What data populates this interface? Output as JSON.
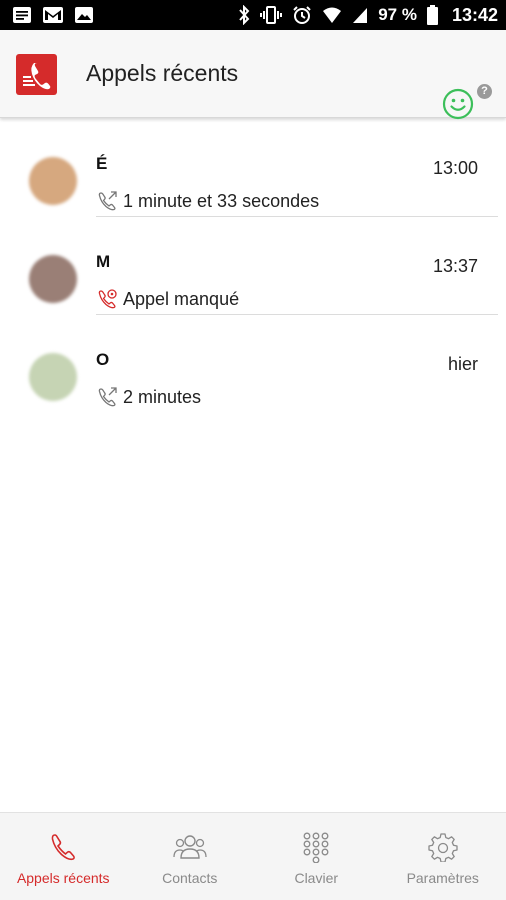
{
  "status_bar": {
    "battery": "97 %",
    "time": "13:42"
  },
  "app_bar": {
    "title": "Appels récents",
    "help": "?"
  },
  "calls": [
    {
      "name": "É",
      "time": "13:00",
      "detail": "1 minute et 33 secondes",
      "type": "outgoing",
      "avatar_color": "#d6a87f"
    },
    {
      "name": "M",
      "time": "13:37",
      "detail": "Appel manqué",
      "type": "missed",
      "avatar_color": "#9a7f76"
    },
    {
      "name": "O",
      "time": "hier",
      "detail": "2 minutes",
      "type": "outgoing",
      "avatar_color": "#c6d4b4"
    }
  ],
  "bottom_nav": {
    "items": [
      {
        "label": "Appels récents",
        "icon": "phone-icon",
        "active": true
      },
      {
        "label": "Contacts",
        "icon": "contacts-icon",
        "active": false
      },
      {
        "label": "Clavier",
        "icon": "keypad-icon",
        "active": false
      },
      {
        "label": "Paramètres",
        "icon": "gear-icon",
        "active": false
      }
    ]
  },
  "colors": {
    "accent": "#d52b2b",
    "smiley": "#3cbf5a",
    "missed": "#d52b2b",
    "muted": "#8a8a8a"
  }
}
